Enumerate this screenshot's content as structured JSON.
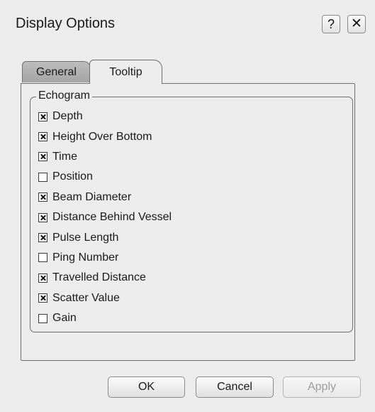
{
  "window": {
    "title": "Display Options",
    "help_label": "?",
    "close_label": "✕"
  },
  "tabs": [
    {
      "label": "General",
      "active": false
    },
    {
      "label": "Tooltip",
      "active": true
    }
  ],
  "group": {
    "title": "Echogram",
    "items": [
      {
        "label": "Depth",
        "checked": true
      },
      {
        "label": "Height Over Bottom",
        "checked": true
      },
      {
        "label": "Time",
        "checked": true
      },
      {
        "label": "Position",
        "checked": false
      },
      {
        "label": "Beam Diameter",
        "checked": true
      },
      {
        "label": "Distance Behind Vessel",
        "checked": true
      },
      {
        "label": "Pulse Length",
        "checked": true
      },
      {
        "label": "Ping Number",
        "checked": false
      },
      {
        "label": "Travelled Distance",
        "checked": true
      },
      {
        "label": "Scatter Value",
        "checked": true
      },
      {
        "label": "Gain",
        "checked": false
      }
    ]
  },
  "buttons": {
    "ok": "OK",
    "cancel": "Cancel",
    "apply": "Apply",
    "apply_enabled": false
  }
}
